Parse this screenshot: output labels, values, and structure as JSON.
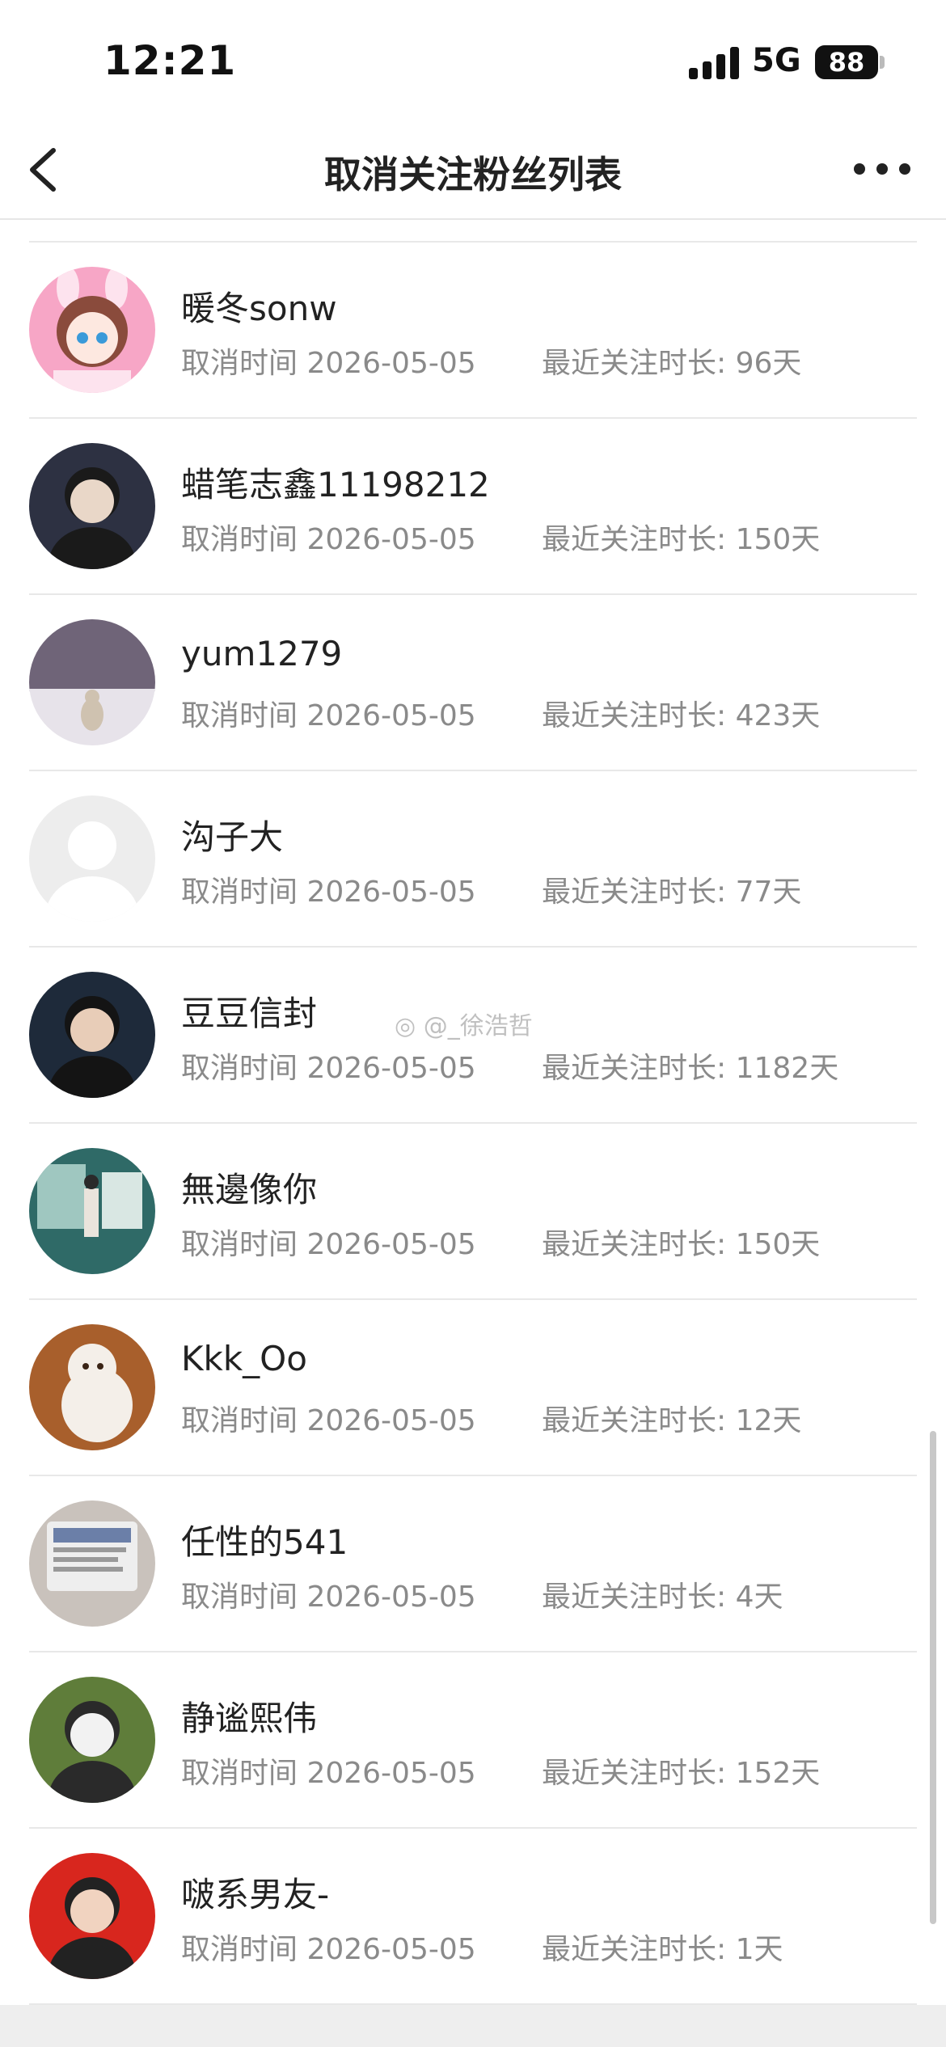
{
  "status_bar": {
    "time": "12:21",
    "network": "5G",
    "battery": "88"
  },
  "nav": {
    "title": "取消关注粉丝列表",
    "back_icon": "chevron-left-icon",
    "more_icon": "more-dots-icon"
  },
  "list": {
    "items": [
      {
        "name": "暖冬sonw",
        "cancel_time": "取消时间 2026-05-05",
        "duration": "最近关注时长: 96天",
        "avatar": "anime-girl-avatar",
        "avatar_colors": [
          "#f7a6c6",
          "#fde3ee",
          "#8a4b3c"
        ]
      },
      {
        "name": "蜡笔志鑫11198212",
        "cancel_time": "取消时间 2026-05-05",
        "duration": "最近关注时长: 150天",
        "avatar": "person-avatar",
        "avatar_colors": [
          "#2d3142",
          "#e9d7c8",
          "#1a1a1a"
        ]
      },
      {
        "name": "yum1279",
        "cancel_time": "取消时间 2026-05-05",
        "duration": "最近关注时长: 423天",
        "avatar": "snow-landscape-avatar",
        "avatar_colors": [
          "#6f6478",
          "#e7e3ea",
          "#cfc2b0"
        ]
      },
      {
        "name": "沟子大",
        "cancel_time": "取消时间 2026-05-05",
        "duration": "最近关注时长: 77天",
        "avatar": "default-user-avatar",
        "avatar_colors": [
          "#ededed",
          "#ffffff",
          "#f8f8f8"
        ]
      },
      {
        "name": "豆豆信封",
        "cancel_time": "取消时间 2026-05-05",
        "duration": "最近关注时长: 1182天",
        "avatar": "person-avatar",
        "avatar_colors": [
          "#1e2a3a",
          "#e8cdb8",
          "#141414"
        ]
      },
      {
        "name": "無邊像你",
        "cancel_time": "取消时间 2026-05-05",
        "duration": "最近关注时长: 150天",
        "avatar": "street-photo-avatar",
        "avatar_colors": [
          "#2f6a67",
          "#9fc7c0",
          "#d9e7e3"
        ]
      },
      {
        "name": "Kkk_Oo",
        "cancel_time": "取消时间 2026-05-05",
        "duration": "最近关注时长: 12天",
        "avatar": "white-dog-avatar",
        "avatar_colors": [
          "#a85f2c",
          "#f4efe9",
          "#3a2416"
        ]
      },
      {
        "name": "任性的541",
        "cancel_time": "取消时间 2026-05-05",
        "duration": "最近关注时长: 4天",
        "avatar": "phone-screen-avatar",
        "avatar_colors": [
          "#c9c2bc",
          "#eeeeee",
          "#6b7fa8"
        ]
      },
      {
        "name": "静谧熙伟",
        "cancel_time": "取消时间 2026-05-05",
        "duration": "最近关注时长: 152天",
        "avatar": "person-outdoor-avatar",
        "avatar_colors": [
          "#5f7d3a",
          "#f2f2f2",
          "#2a2a2a"
        ]
      },
      {
        "name": "啵系男友-",
        "cancel_time": "取消时间 2026-05-05",
        "duration": "最近关注时长: 1天",
        "avatar": "person-red-avatar",
        "avatar_colors": [
          "#d8261e",
          "#f1d3c0",
          "#222222"
        ]
      }
    ]
  },
  "watermark": "@_徐浩哲",
  "watermark_icon": "weibo-logo-icon"
}
